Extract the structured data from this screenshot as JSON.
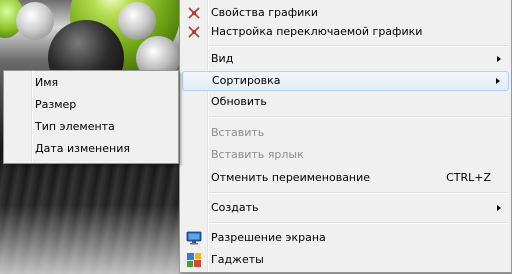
{
  "context_menu": {
    "items": [
      {
        "label": "Свойства графики",
        "icon": "intel-graphics-icon"
      },
      {
        "label": "Настройка переключаемой графики",
        "icon": "intel-graphics-icon"
      },
      {
        "label": "Вид"
      },
      {
        "label": "Сортировка"
      },
      {
        "label": "Обновить"
      },
      {
        "label": "Вставить",
        "disabled": true
      },
      {
        "label": "Вставить ярлык",
        "disabled": true
      },
      {
        "label": "Отменить переименование",
        "shortcut": "CTRL+Z"
      },
      {
        "label": "Создать"
      },
      {
        "label": "Разрешение экрана",
        "icon": "display-icon"
      },
      {
        "label": "Гаджеты",
        "icon": "gadgets-icon"
      }
    ]
  },
  "sort_submenu": {
    "items": [
      {
        "label": "Имя"
      },
      {
        "label": "Размер"
      },
      {
        "label": "Тип элемента"
      },
      {
        "label": "Дата изменения"
      }
    ]
  },
  "colors": {
    "menu_background": "#f0f0f0",
    "highlight_border": "#aecff7",
    "disabled_text": "#8d8d8d",
    "wallpaper_accent": "#8cc63f"
  }
}
